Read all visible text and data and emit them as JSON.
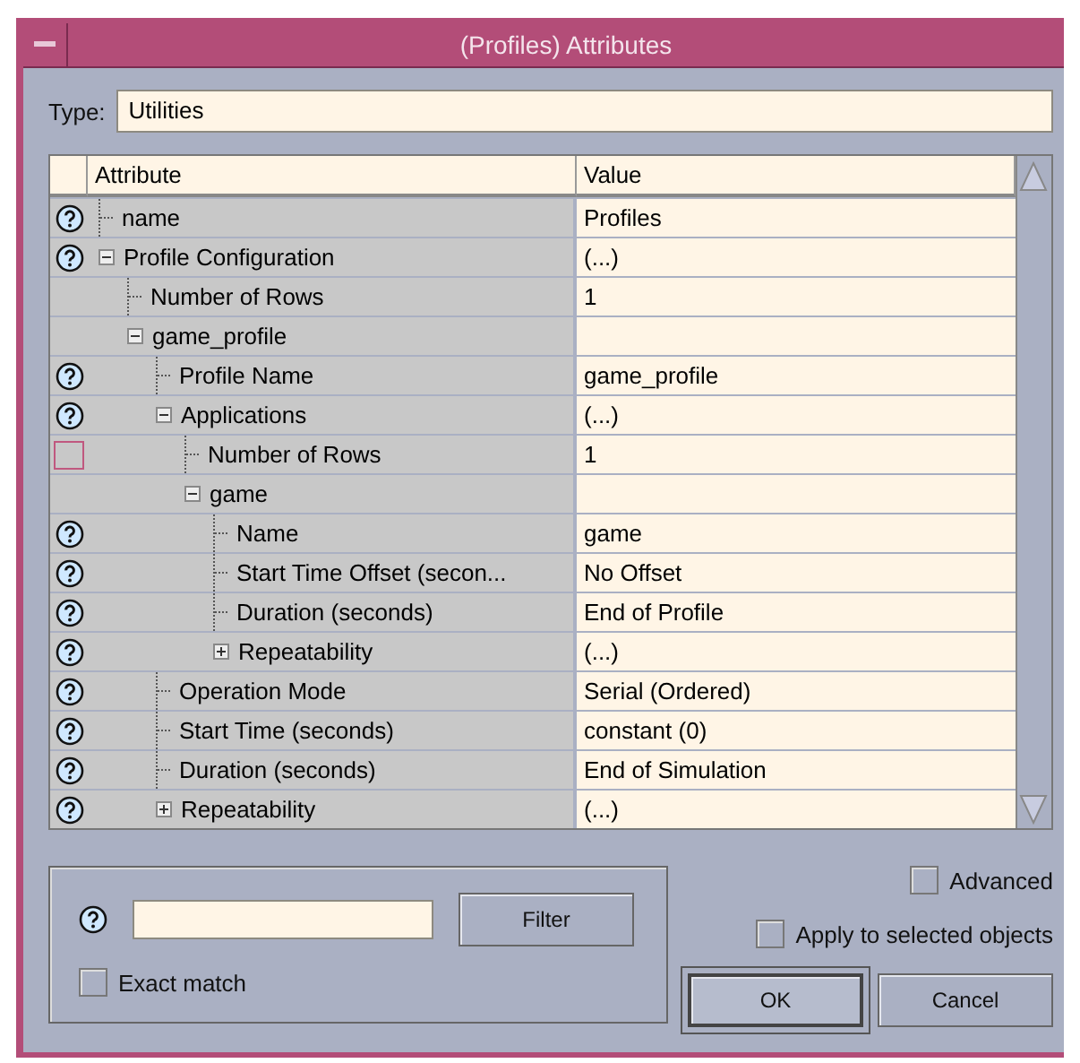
{
  "window": {
    "title": "(Profiles) Attributes"
  },
  "type_field": {
    "label": "Type:",
    "value": "Utilities"
  },
  "table": {
    "columns": [
      "Attribute",
      "Value"
    ],
    "rows": [
      {
        "name": "name",
        "value": "Profiles",
        "kind": "help"
      },
      {
        "name": "Profile Configuration",
        "value": "(...)",
        "kind": "help",
        "expanded": true,
        "children": [
          {
            "name": "Number of Rows",
            "value": "1"
          },
          {
            "name": "game_profile",
            "expanded": true,
            "children": [
              {
                "name": "Profile Name",
                "value": "game_profile",
                "kind": "help"
              },
              {
                "name": "Applications",
                "value": "(...)",
                "kind": "help",
                "expanded": true,
                "children": [
                  {
                    "name": "Number of Rows",
                    "value": "1",
                    "kind": "flagged"
                  },
                  {
                    "name": "game",
                    "expanded": true,
                    "children": [
                      {
                        "name": "Name",
                        "value": "game",
                        "kind": "help"
                      },
                      {
                        "name": "Start Time Offset (secon...",
                        "value": "No Offset",
                        "kind": "help"
                      },
                      {
                        "name": "Duration (seconds)",
                        "value": "End of Profile",
                        "kind": "help"
                      },
                      {
                        "name": "Repeatability",
                        "value": "(...)",
                        "kind": "help",
                        "expanded": false
                      }
                    ]
                  }
                ]
              },
              {
                "name": "Operation Mode",
                "value": "Serial (Ordered)",
                "kind": "help"
              },
              {
                "name": "Start Time (seconds)",
                "value": "constant (0)",
                "kind": "help"
              },
              {
                "name": "Duration (seconds)",
                "value": "End of Simulation",
                "kind": "help"
              },
              {
                "name": "Repeatability",
                "value": "(...)",
                "kind": "help",
                "expanded": false
              }
            ]
          }
        ]
      }
    ]
  },
  "filter": {
    "exact_match": {
      "label": "Exact match",
      "checked": false
    },
    "button": "Filter"
  },
  "advanced": {
    "label": "Advanced",
    "checked": false
  },
  "apply_selected": {
    "label": "Apply to selected objects",
    "checked": false
  },
  "buttons": [
    {
      "label": "OK",
      "focused": true
    },
    {
      "label": "Cancel",
      "focused": false
    }
  ]
}
